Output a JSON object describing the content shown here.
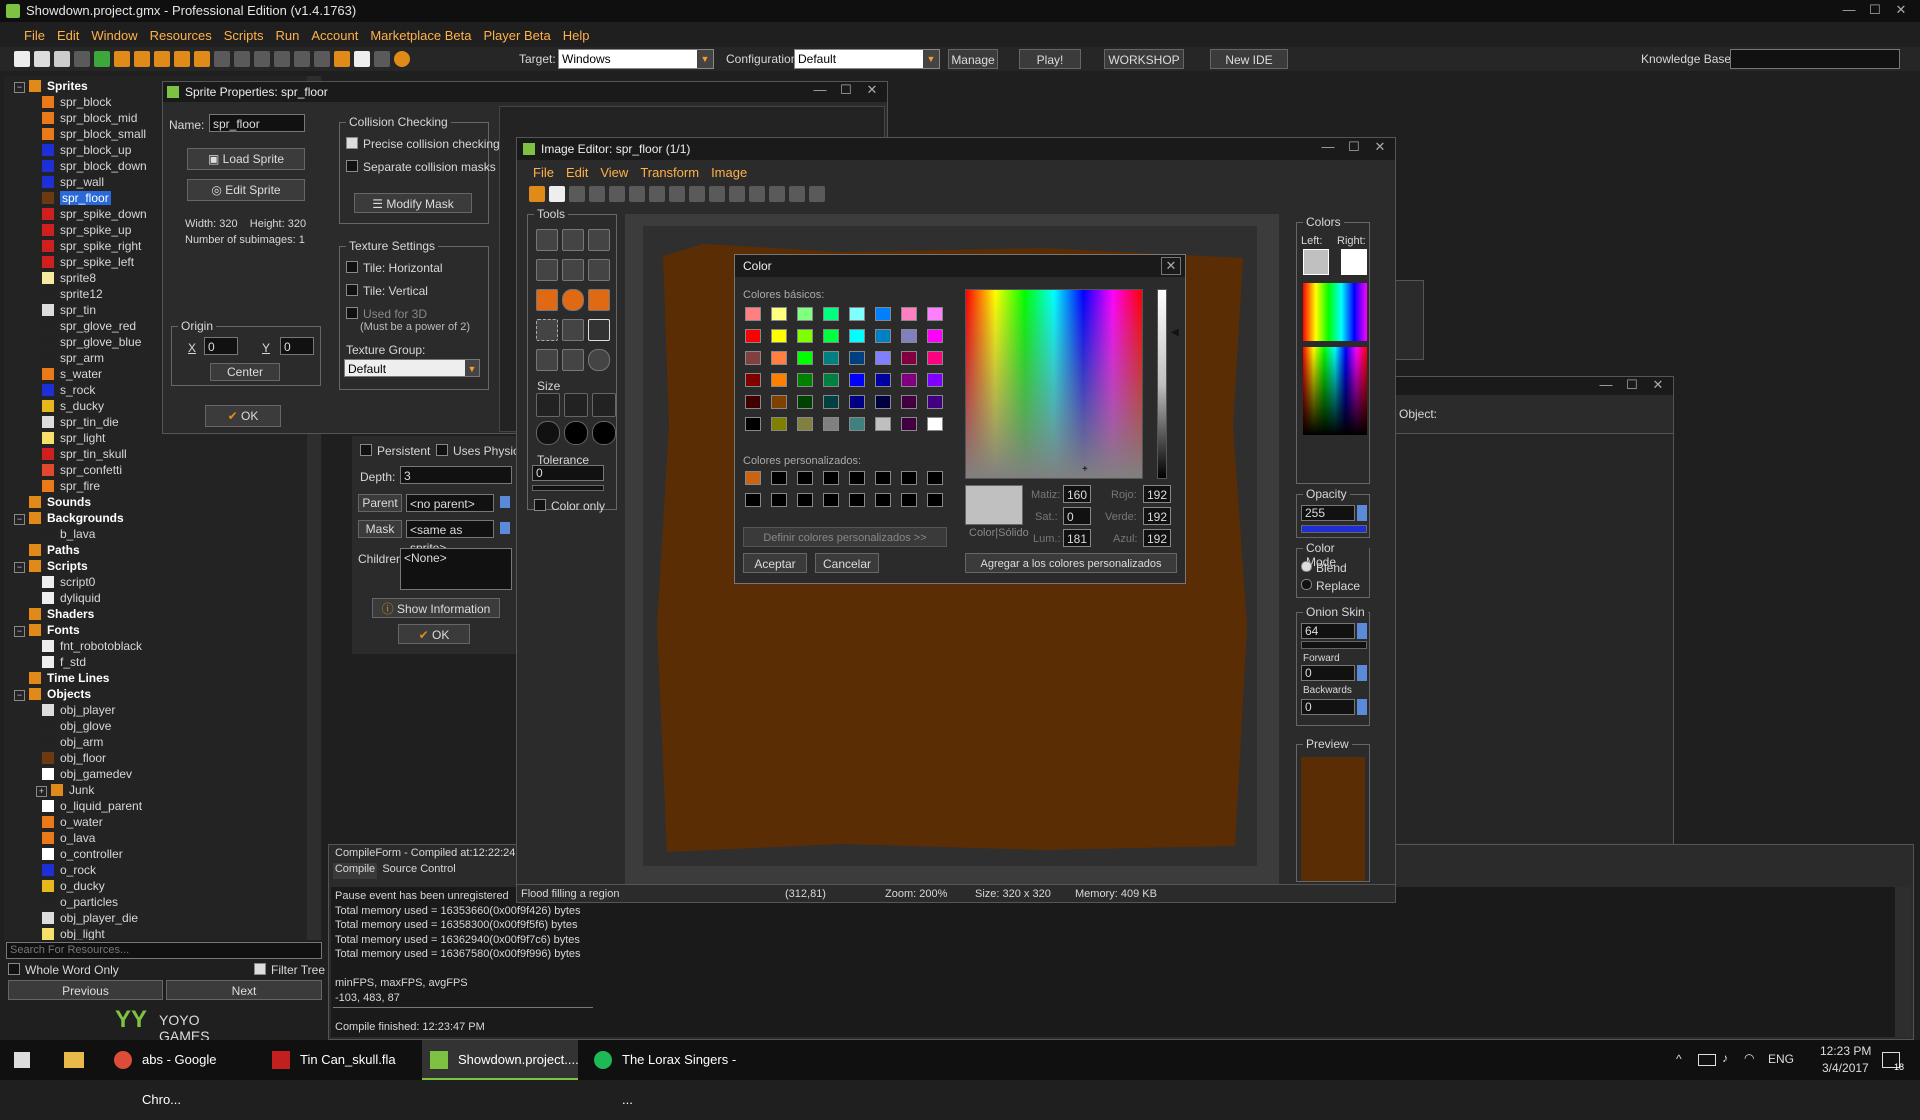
{
  "app": {
    "title": "Showdown.project.gmx - Professional Edition (v1.4.1763)",
    "menu": [
      "File",
      "Edit",
      "Window",
      "Resources",
      "Scripts",
      "Run",
      "Account",
      "Marketplace Beta",
      "Player Beta",
      "Help"
    ]
  },
  "toolbar": {
    "target_label": "Target:",
    "target_value": "Windows",
    "config_label": "Configuration:",
    "config_value": "Default",
    "manage": "Manage",
    "play": "Play!",
    "workshop": "WORKSHOP",
    "new_ide": "New IDE",
    "kb_label": "Knowledge Base:"
  },
  "tree": {
    "items": [
      {
        "label": "Sprites",
        "type": "folder",
        "open": true
      },
      {
        "label": "spr_block",
        "color": "#e87a1a"
      },
      {
        "label": "spr_block_mid",
        "color": "#e87a1a"
      },
      {
        "label": "spr_block_small",
        "color": "#e87a1a"
      },
      {
        "label": "spr_block_up",
        "color": "#1e2fd6"
      },
      {
        "label": "spr_block_down",
        "color": "#1e2fd6"
      },
      {
        "label": "spr_wall",
        "color": "#1e2fd6"
      },
      {
        "label": "spr_floor",
        "color": "#6b3a10",
        "selected": true
      },
      {
        "label": "spr_spike_down",
        "color": "#d01f1f"
      },
      {
        "label": "spr_spike_up",
        "color": "#d01f1f"
      },
      {
        "label": "spr_spike_right",
        "color": "#d01f1f"
      },
      {
        "label": "spr_spike_left",
        "color": "#d01f1f"
      },
      {
        "label": "sprite8",
        "color": "#f4eaa0"
      },
      {
        "label": "sprite12",
        "color": "#222222"
      },
      {
        "label": "spr_tin",
        "color": "#dddddd"
      },
      {
        "label": "spr_glove_red",
        "color": "#222222"
      },
      {
        "label": "spr_glove_blue",
        "color": "#222222"
      },
      {
        "label": "spr_arm",
        "color": "#222222"
      },
      {
        "label": "s_water",
        "color": "#e87a1a"
      },
      {
        "label": "s_rock",
        "color": "#1e2fd6"
      },
      {
        "label": "s_ducky",
        "color": "#e8b81a"
      },
      {
        "label": "spr_tin_die",
        "color": "#dddddd"
      },
      {
        "label": "spr_light",
        "color": "#f4e06a"
      },
      {
        "label": "spr_tin_skull",
        "color": "#d01f1f"
      },
      {
        "label": "spr_confetti",
        "color": "#e04a2a"
      },
      {
        "label": "spr_fire",
        "color": "#e87a1a"
      },
      {
        "label": "Sounds",
        "type": "folder"
      },
      {
        "label": "Backgrounds",
        "type": "folder",
        "open": true
      },
      {
        "label": "b_lava",
        "color": "#222222"
      },
      {
        "label": "Paths",
        "type": "folder"
      },
      {
        "label": "Scripts",
        "type": "folder",
        "open": true
      },
      {
        "label": "script0",
        "color": "#eeeeee"
      },
      {
        "label": "dyliquid",
        "color": "#eeeeee"
      },
      {
        "label": "Shaders",
        "type": "folder"
      },
      {
        "label": "Fonts",
        "type": "folder",
        "open": true
      },
      {
        "label": "fnt_robotoblack",
        "color": "#eeeeee"
      },
      {
        "label": "f_std",
        "color": "#eeeeee"
      },
      {
        "label": "Time Lines",
        "type": "folder"
      },
      {
        "label": "Objects",
        "type": "folder",
        "open": true
      },
      {
        "label": "obj_player",
        "color": "#dddddd"
      },
      {
        "label": "obj_glove",
        "color": "#222222"
      },
      {
        "label": "obj_arm",
        "color": "#222222"
      },
      {
        "label": "obj_floor",
        "color": "#6b3a10"
      },
      {
        "label": "obj_gamedev",
        "color": "#ffffff"
      },
      {
        "label": "Junk",
        "type": "subfolder"
      },
      {
        "label": "o_liquid_parent",
        "color": "#ffffff"
      },
      {
        "label": "o_water",
        "color": "#e87a1a"
      },
      {
        "label": "o_lava",
        "color": "#e87a1a"
      },
      {
        "label": "o_controller",
        "color": "#ffffff"
      },
      {
        "label": "o_rock",
        "color": "#1e2fd6"
      },
      {
        "label": "o_ducky",
        "color": "#e8b81a"
      },
      {
        "label": "o_particles",
        "color": "#222222"
      },
      {
        "label": "obj_player_die",
        "color": "#dddddd"
      },
      {
        "label": "obj_light",
        "color": "#f4e06a"
      }
    ],
    "search_placeholder": "Search For Resources...",
    "whole_word": "Whole Word Only",
    "filter_tree": "Filter Tree",
    "previous": "Previous",
    "next": "Next",
    "logo": "YOYO GAMES"
  },
  "sprite_props": {
    "title": "Sprite Properties: spr_floor",
    "name_label": "Name:",
    "name_value": "spr_floor",
    "load_sprite": "Load Sprite",
    "edit_sprite": "Edit Sprite",
    "width_height": "Width: 320    Height: 320",
    "subimages": "Number of subimages: 1",
    "origin_label": "Origin",
    "x_label": "X",
    "x_value": "0",
    "y_label": "Y",
    "y_value": "0",
    "center": "Center",
    "ok": "OK",
    "collision_label": "Collision Checking",
    "precise": "Precise collision checking",
    "separate": "Separate collision masks",
    "modify_mask": "Modify Mask",
    "texture_label": "Texture Settings",
    "tile_h": "Tile: Horizontal",
    "tile_v": "Tile: Vertical",
    "used_3d": "Used for 3D",
    "power_two": "(Must be a power of 2)",
    "texture_group_label": "Texture Group:",
    "texture_group_value": "Default"
  },
  "object_props": {
    "persistent": "Persistent",
    "uses_physics": "Uses Physics",
    "depth_label": "Depth:",
    "depth_value": "3",
    "parent_label": "Parent",
    "parent_value": "<no parent>",
    "mask_label": "Mask",
    "mask_value": "<same as sprite>",
    "children_label": "Children:",
    "children_value": "<None>",
    "show_info": "Show Information",
    "ok": "OK",
    "object_label": "Object:"
  },
  "compile": {
    "title": "CompileForm - Compiled at:12:22:24 F",
    "tab_compile": "Compile",
    "tab_source": "Source Control",
    "lines": [
      "Pause event has been unregistered",
      "Total memory used = 16353660(0x00f9f426) bytes",
      "Total memory used = 16358300(0x00f9f5f6) bytes",
      "Total memory used = 16362940(0x00f9f7c6) bytes",
      "Total memory used = 16367580(0x00f9f996) bytes",
      "",
      "minFPS, maxFPS, avgFPS",
      "-103, 483, 87",
      "",
      "Compile finished: 12:23:47 PM"
    ]
  },
  "image_editor": {
    "title": "Image Editor: spr_floor (1/1)",
    "menu": [
      "File",
      "Edit",
      "View",
      "Transform",
      "Image"
    ],
    "tools_label": "Tools",
    "size_label": "Size",
    "tolerance_label": "Tolerance",
    "tolerance_value": "0",
    "color_only": "Color only",
    "status_action": "Flood filling a region",
    "status_coords": "(312,81)",
    "status_zoom": "Zoom: 200%",
    "status_size": "Size: 320 x 320",
    "status_memory": "Memory: 409 KB",
    "colors_label": "Colors",
    "left_label": "Left:",
    "right_label": "Right:",
    "opacity_label": "Opacity",
    "opacity_value": "255",
    "color_mode_label": "Color Mode",
    "blend": "Blend",
    "replace": "Replace",
    "onion_label": "Onion Skin",
    "onion_value": "64",
    "forward_label": "Forward",
    "forward_value": "0",
    "backwards_label": "Backwards",
    "backwards_value": "0",
    "preview_label": "Preview"
  },
  "color_dialog": {
    "title": "Color",
    "basic_label": "Colores básicos:",
    "custom_label": "Colores personalizados:",
    "define_custom": "Definir colores personalizados >>",
    "accept": "Aceptar",
    "cancel": "Cancelar",
    "add_custom": "Agregar a los colores personalizados",
    "color_solid": "Color|Sólido",
    "hue_label": "Matiz:",
    "hue_value": "160",
    "sat_label": "Sat.:",
    "sat_value": "0",
    "lum_label": "Lum.:",
    "lum_value": "181",
    "red_label": "Rojo:",
    "red_value": "192",
    "green_label": "Verde:",
    "green_value": "192",
    "blue_label": "Azul:",
    "blue_value": "192",
    "basic_colors": [
      "#ff8080",
      "#ffff80",
      "#80ff80",
      "#00ff80",
      "#80ffff",
      "#0080ff",
      "#ff80c0",
      "#ff80ff",
      "#ff0000",
      "#ffff00",
      "#80ff00",
      "#00ff40",
      "#00ffff",
      "#0080c0",
      "#8080c0",
      "#ff00ff",
      "#804040",
      "#ff8040",
      "#00ff00",
      "#008080",
      "#004080",
      "#8080ff",
      "#800040",
      "#ff0080",
      "#800000",
      "#ff8000",
      "#008000",
      "#008040",
      "#0000ff",
      "#0000a0",
      "#800080",
      "#8000ff",
      "#400000",
      "#804000",
      "#004000",
      "#004040",
      "#000080",
      "#000040",
      "#400040",
      "#400080",
      "#000000",
      "#808000",
      "#808040",
      "#808080",
      "#408080",
      "#c0c0c0",
      "#400040",
      "#ffffff"
    ],
    "custom_colors": [
      "#c86414",
      "#000000",
      "#000000",
      "#000000",
      "#000000",
      "#000000",
      "#000000",
      "#000000",
      "#000000",
      "#000000",
      "#000000",
      "#000000",
      "#000000",
      "#000000",
      "#000000",
      "#000000"
    ]
  },
  "taskbar": {
    "items": [
      "abs - Google Chro...",
      "Tin Can_skull.fla",
      "Showdown.project....",
      "The Lorax Singers - ..."
    ],
    "lang": "ENG",
    "time": "12:23 PM",
    "date": "3/4/2017",
    "notifications": "18"
  }
}
